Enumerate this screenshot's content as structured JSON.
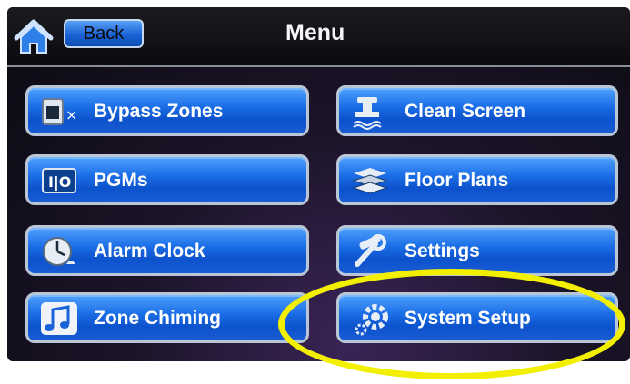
{
  "header": {
    "back_label": "Back",
    "title": "Menu",
    "home_icon": "home-icon"
  },
  "menu": {
    "left": [
      {
        "label": "Bypass Zones",
        "icon": "bypass-zones-icon"
      },
      {
        "label": "PGMs",
        "icon": "pgm-icon"
      },
      {
        "label": "Alarm Clock",
        "icon": "alarm-clock-icon"
      },
      {
        "label": "Zone Chiming",
        "icon": "music-note-icon"
      }
    ],
    "right": [
      {
        "label": "Clean Screen",
        "icon": "faucet-icon"
      },
      {
        "label": "Floor Plans",
        "icon": "floor-plans-icon"
      },
      {
        "label": "Settings",
        "icon": "tools-icon"
      },
      {
        "label": "System Setup",
        "icon": "gears-icon"
      }
    ]
  },
  "annotation": {
    "highlighted_item": "System Setup",
    "color": "#f2ef00"
  },
  "colors": {
    "button_blue": "#1c6fe6",
    "button_border": "#b9c6d6",
    "background": "#1c1428"
  }
}
